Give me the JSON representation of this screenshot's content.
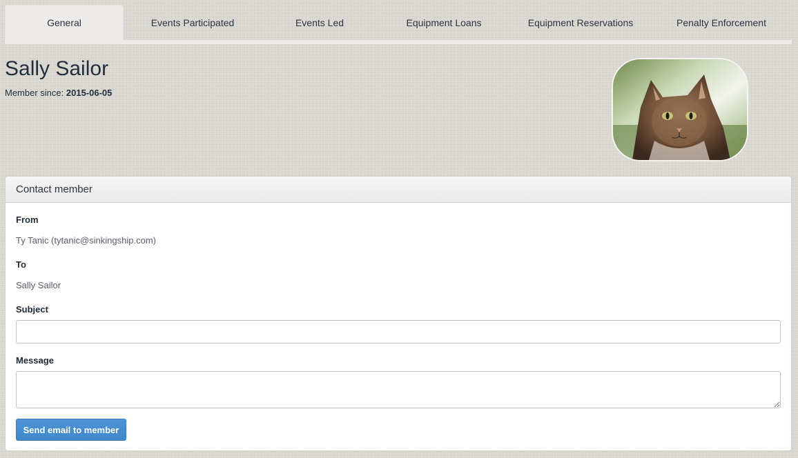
{
  "tabs": [
    {
      "label": "General",
      "active": true
    },
    {
      "label": "Events Participated",
      "active": false
    },
    {
      "label": "Events Led",
      "active": false
    },
    {
      "label": "Equipment Loans",
      "active": false
    },
    {
      "label": "Equipment Reservations",
      "active": false
    },
    {
      "label": "Penalty Enforcement",
      "active": false
    }
  ],
  "member": {
    "name": "Sally Sailor",
    "since_label": "Member since:",
    "since_date": "2015-06-05",
    "photo": "cat-photo"
  },
  "contact": {
    "heading": "Contact member",
    "from_label": "From",
    "from_value": "Ty Tanic (tytanic@sinkingship.com)",
    "to_label": "To",
    "to_value": "Sally Sailor",
    "subject_label": "Subject",
    "subject_value": "",
    "message_label": "Message",
    "message_value": "",
    "send_label": "Send email to member"
  },
  "colors": {
    "background": "#d9d6d0",
    "active_tab": "#ecebe9",
    "button": "#428bca",
    "text": "#1f2a36"
  }
}
